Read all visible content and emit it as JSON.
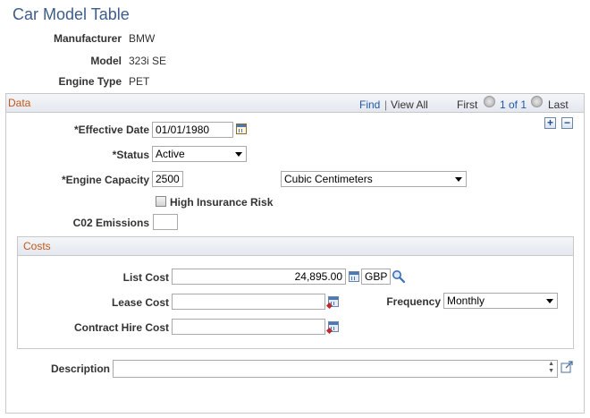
{
  "page": {
    "title": "Car Model Table"
  },
  "header": {
    "manufacturer_label": "Manufacturer",
    "manufacturer_value": "BMW",
    "model_label": "Model",
    "model_value": "323i SE",
    "engine_type_label": "Engine Type",
    "engine_type_value": "PET"
  },
  "data_section": {
    "title": "Data",
    "find_label": "Find",
    "separator": "|",
    "view_all_label": "View All",
    "first_label": "First",
    "pager_text": "1 of 1",
    "last_label": "Last",
    "add_label": "+",
    "remove_label": "−",
    "effective_date_label": "*Effective Date",
    "effective_date_value": "01/01/1980",
    "status_label": "*Status",
    "status_value": "Active",
    "engine_capacity_label": "*Engine Capacity",
    "engine_capacity_value": "2500",
    "engine_units_value": "Cubic Centimeters",
    "high_insurance_label": "High Insurance Risk",
    "high_insurance_checked": false,
    "co2_label": "C02 Emissions",
    "co2_value": ""
  },
  "costs": {
    "title": "Costs",
    "list_cost_label": "List Cost",
    "list_cost_value": "24,895.00",
    "currency_value": "GBP",
    "lease_cost_label": "Lease Cost",
    "lease_cost_value": "",
    "frequency_label": "Frequency",
    "frequency_value": "Monthly",
    "contract_hire_label": "Contract Hire Cost",
    "contract_hire_value": ""
  },
  "description": {
    "label": "Description",
    "value": ""
  },
  "colors": {
    "title": "#3d5d88",
    "section_title": "#c05a1a",
    "link": "#1e5aa8"
  }
}
